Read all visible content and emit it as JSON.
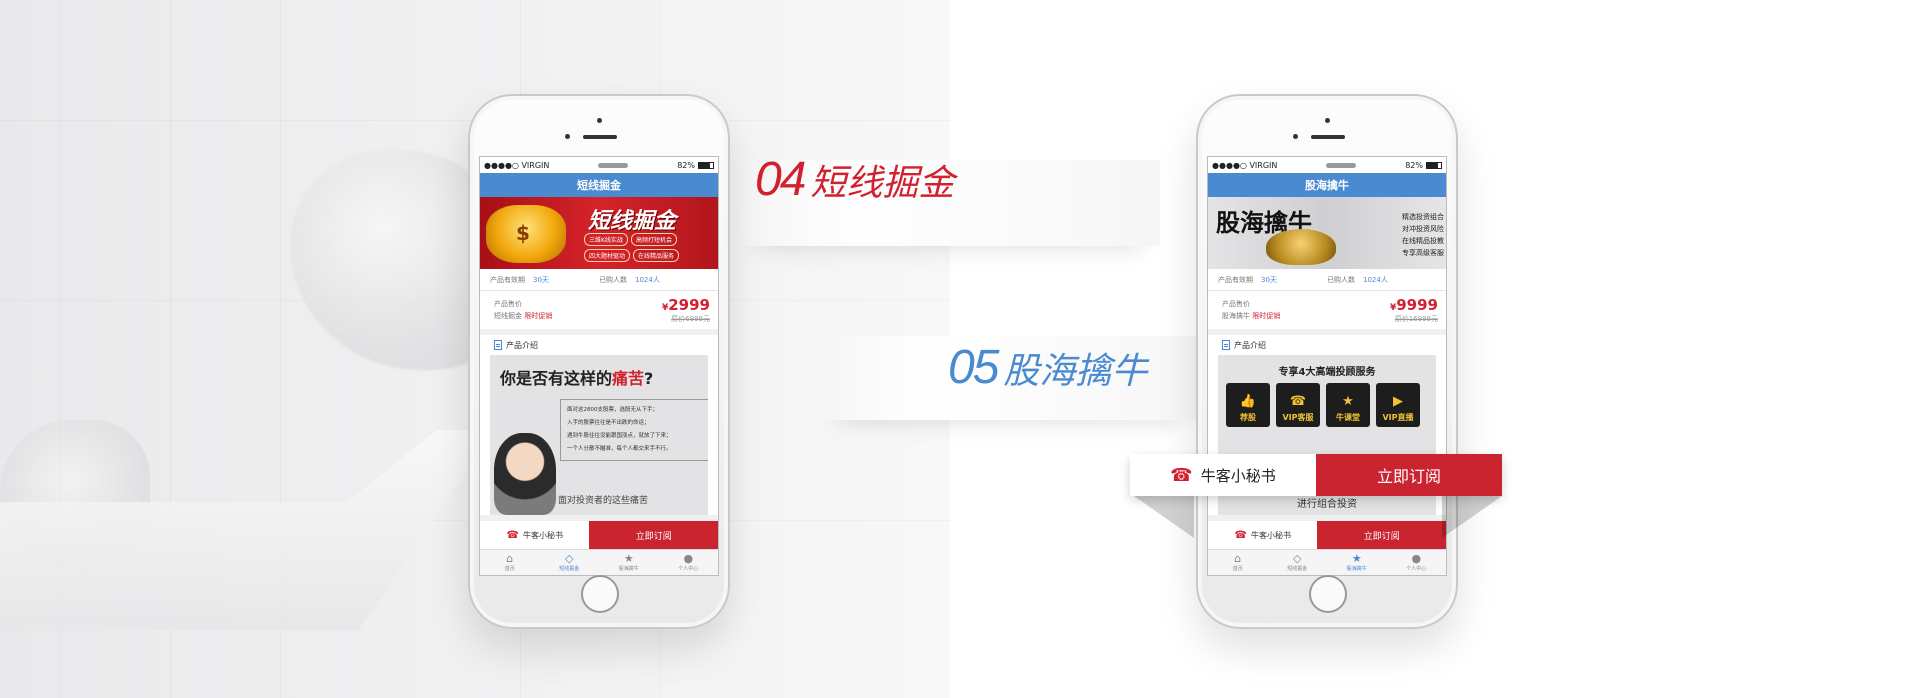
{
  "sections": [
    {
      "number": "04",
      "title": "短线掘金"
    },
    {
      "number": "05",
      "title": "股海擒牛"
    }
  ],
  "status": {
    "carrier": "●●●●○ VIRGIN",
    "battery": "82%"
  },
  "phones": [
    {
      "nav_title": "短线掘金",
      "banner": {
        "title": "短线掘金",
        "symbol": "$",
        "tags": [
          "三维K线实战",
          "高频打短机会",
          "四大题材驱动",
          "在线精品服务"
        ]
      },
      "info": {
        "validity_label": "产品有效期",
        "validity": "30天",
        "buyers_label": "已购人数",
        "buyers": "1024人"
      },
      "price": {
        "label": "产品售价",
        "name": "短线掘金",
        "promo": "限时促销",
        "currency": "¥",
        "amount": "2999",
        "original": "原价6999元"
      },
      "intro_label": "产品介绍",
      "intro": {
        "heading_pre": "你是否有这样的",
        "heading_em": "痛苦",
        "heading_post": "?",
        "pains": [
          "面对这2800支股票，选股无从下手；",
          "入手的股票往往是不出跌的命运；",
          "遇到牛股往往没能跟国涨点，就放了下来；",
          "一个人分散不瞄准，每个人都交来手不行。"
        ],
        "subtitle": "面对投资者的这些痛苦"
      },
      "cta": {
        "assistant": "牛客小秘书",
        "subscribe": "立即订阅"
      },
      "tabs": [
        "首页",
        "短线掘金",
        "股海擒牛",
        "个人中心"
      ],
      "active_tab": 1
    },
    {
      "nav_title": "股海擒牛",
      "banner": {
        "title": "股海擒牛",
        "lines": [
          "精选投资组合",
          "对冲投资风险",
          "在线精品投教",
          "专享高级客服"
        ]
      },
      "info": {
        "validity_label": "产品有效期",
        "validity": "30天",
        "buyers_label": "已购人数",
        "buyers": "1024人"
      },
      "price": {
        "label": "产品售价",
        "name": "股海擒牛",
        "promo": "限时促销",
        "currency": "¥",
        "amount": "9999",
        "original": "原价16999元"
      },
      "intro_label": "产品介绍",
      "services": {
        "title": "专享4大高端投顾服务",
        "items": [
          {
            "icon": "thumb-up-icon",
            "glyph": "👍",
            "label": "荐股"
          },
          {
            "icon": "vip-support-icon",
            "glyph": "☎",
            "label": "VIP客服"
          },
          {
            "icon": "star-icon",
            "glyph": "★",
            "label": "牛课堂"
          },
          {
            "icon": "video-icon",
            "glyph": "▶",
            "label": "VIP直播"
          }
        ],
        "subtitle": "进行组合投资"
      },
      "cta": {
        "assistant": "牛客小秘书",
        "subscribe": "立即订阅"
      },
      "tabs": [
        "首页",
        "短线掘金",
        "股海擒牛",
        "个人中心"
      ],
      "active_tab": 2
    }
  ],
  "callout": {
    "assistant": "牛客小秘书",
    "subscribe": "立即订阅"
  },
  "colors": {
    "brand_red": "#d2202e",
    "brand_blue": "#4a8ad0",
    "cta_red": "#c9242f"
  }
}
